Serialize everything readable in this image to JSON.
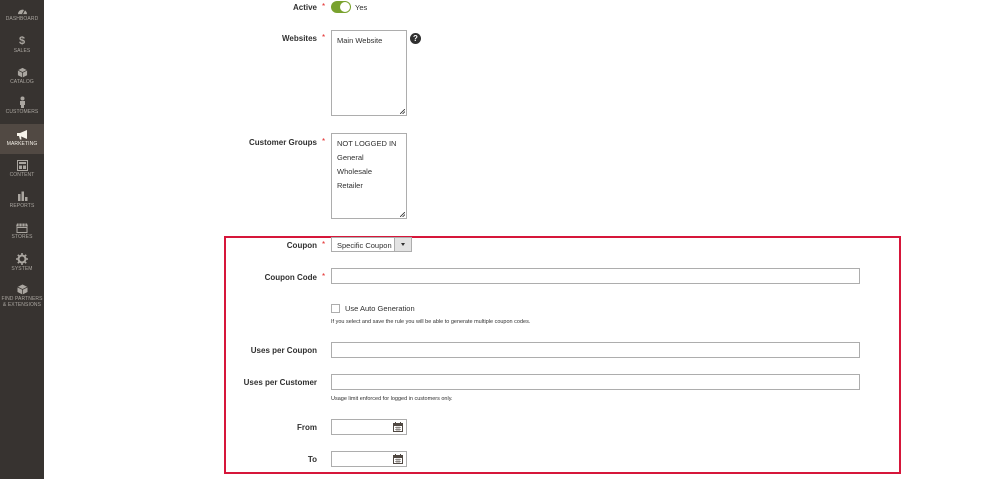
{
  "sidebar": {
    "items": [
      {
        "label": "DASHBOARD",
        "icon": "dashboard-icon"
      },
      {
        "label": "SALES",
        "icon": "dollar-icon"
      },
      {
        "label": "CATALOG",
        "icon": "cube-icon"
      },
      {
        "label": "CUSTOMERS",
        "icon": "person-icon"
      },
      {
        "label": "MARKETING",
        "icon": "megaphone-icon",
        "active": true
      },
      {
        "label": "CONTENT",
        "icon": "layout-icon"
      },
      {
        "label": "REPORTS",
        "icon": "bar-chart-icon"
      },
      {
        "label": "STORES",
        "icon": "store-icon"
      },
      {
        "label": "SYSTEM",
        "icon": "gear-icon"
      },
      {
        "label": "FIND PARTNERS",
        "label2": "& EXTENSIONS",
        "icon": "extensions-icon"
      }
    ]
  },
  "form": {
    "active": {
      "label": "Active",
      "value": "Yes"
    },
    "websites": {
      "label": "Websites",
      "options": [
        "Main Website"
      ]
    },
    "customer_groups": {
      "label": "Customer Groups",
      "options": [
        "NOT LOGGED IN",
        "General",
        "Wholesale",
        "Retailer"
      ]
    },
    "coupon": {
      "label": "Coupon",
      "value": "Specific Coupon"
    },
    "coupon_code": {
      "label": "Coupon Code",
      "value": ""
    },
    "auto_generation": {
      "label": "Use Auto Generation",
      "note": "If you select and save the rule you will be able to generate multiple coupon codes."
    },
    "uses_per_coupon": {
      "label": "Uses per Coupon",
      "value": ""
    },
    "uses_per_customer": {
      "label": "Uses per Customer",
      "value": "",
      "note": "Usage limit enforced for logged in customers only."
    },
    "from": {
      "label": "From",
      "value": ""
    },
    "to": {
      "label": "To",
      "value": ""
    }
  },
  "colors": {
    "sidebar_bg": "#373330",
    "sidebar_active": "#514943",
    "toggle_on": "#79a22e",
    "required": "#e22626",
    "highlight": "#d6163a"
  }
}
